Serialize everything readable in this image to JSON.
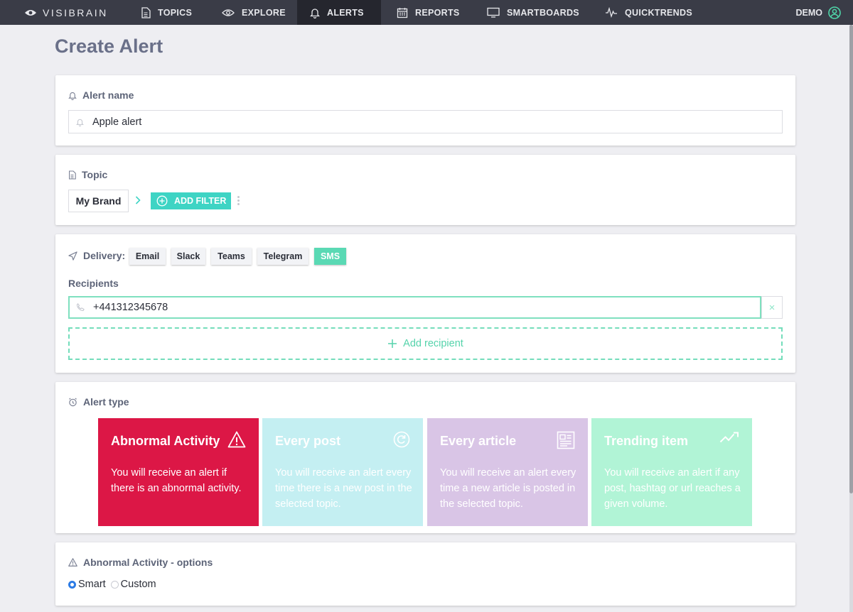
{
  "brand": {
    "name": "VISIBRAIN"
  },
  "nav": [
    {
      "label": "TOPICS",
      "icon": "document-icon",
      "active": false
    },
    {
      "label": "EXPLORE",
      "icon": "eye-icon",
      "active": false
    },
    {
      "label": "ALERTS",
      "icon": "bell-icon",
      "active": true
    },
    {
      "label": "REPORTS",
      "icon": "calendar-icon",
      "active": false
    },
    {
      "label": "SMARTBOARDS",
      "icon": "monitor-icon",
      "active": false
    },
    {
      "label": "QUICKTRENDS",
      "icon": "pulse-icon",
      "active": false
    }
  ],
  "user": {
    "label": "DEMO",
    "icon": "user-circle-icon"
  },
  "page": {
    "title": "Create Alert"
  },
  "alert_name": {
    "label": "Alert name",
    "value": "Apple alert"
  },
  "topic": {
    "label": "Topic",
    "chip": "My Brand",
    "add_filter_label": "ADD FILTER"
  },
  "delivery": {
    "label": "Delivery:",
    "channels": [
      {
        "label": "Email",
        "selected": false
      },
      {
        "label": "Slack",
        "selected": false
      },
      {
        "label": "Teams",
        "selected": false
      },
      {
        "label": "Telegram",
        "selected": false
      },
      {
        "label": "SMS",
        "selected": true
      }
    ],
    "recipients_label": "Recipients",
    "recipients": [
      "+441312345678"
    ],
    "remove_label": "×",
    "add_recipient_label": "Add recipient"
  },
  "alert_type": {
    "label": "Alert type",
    "options": [
      {
        "title": "Abnormal Activity",
        "description": "You will receive an alert if there is an abnormal activity.",
        "icon": "warning-triangle-icon",
        "selected": true,
        "color": "#dc1746"
      },
      {
        "title": "Every post",
        "description": "You will receive an alert every time there is a new post in the selected topic.",
        "icon": "refresh-icon",
        "selected": false,
        "color": "#c4eff2"
      },
      {
        "title": "Every article",
        "description": "You will receive an alert every time a new article is posted in the selected topic.",
        "icon": "newspaper-icon",
        "selected": false,
        "color": "#d9c5e6"
      },
      {
        "title": "Trending item",
        "description": "You will receive an alert if any post, hashtag or url reaches a given volume.",
        "icon": "trend-line-icon",
        "selected": false,
        "color": "#b1f4d6"
      }
    ]
  },
  "options": {
    "label": "Abnormal Activity - options",
    "modes": [
      {
        "label": "Smart",
        "checked": true
      },
      {
        "label": "Custom",
        "checked": false
      }
    ]
  },
  "colors": {
    "accent": "#3ed4c4",
    "success": "#5ad9b4",
    "nav_bg": "#3a3c47",
    "danger": "#dc1746"
  }
}
